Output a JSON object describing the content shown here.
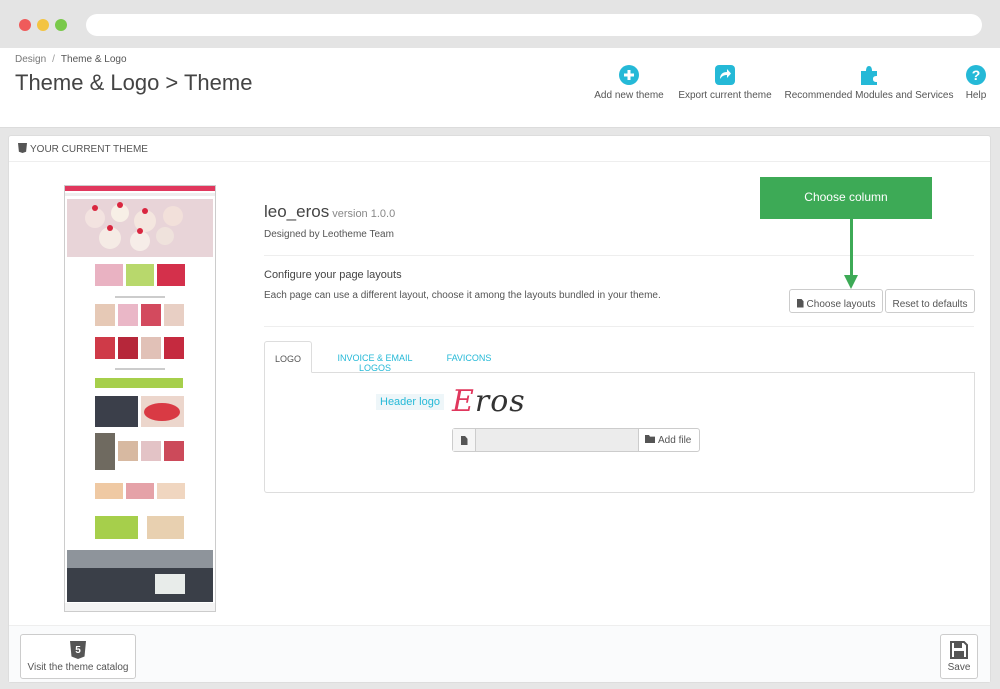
{
  "breadcrumb": {
    "parent": "Design",
    "separator": "/",
    "current": "Theme & Logo"
  },
  "page_title": "Theme & Logo > Theme",
  "toolbar": {
    "add_new_theme": "Add new theme",
    "export_current_theme": "Export current theme",
    "recommended": "Recommended Modules and Services",
    "help": "Help",
    "accent": "#25b9d7"
  },
  "panel": {
    "heading": "YOUR CURRENT THEME",
    "theme_name": "leo_eros",
    "theme_version": "version 1.0.0",
    "designer": "Designed by Leotheme Team",
    "config_title": "Configure your page layouts",
    "config_desc": "Each page can use a different layout, choose it among the layouts bundled in your theme.",
    "choose_layouts": "Choose layouts",
    "reset_defaults": "Reset to defaults",
    "callout": "Choose column",
    "callout_color": "#3daa56"
  },
  "tabs": [
    "LOGO",
    "INVOICE & EMAIL LOGOS",
    "FAVICONS"
  ],
  "logo_tab": {
    "header_logo_label": "Header logo",
    "logo_first": "E",
    "logo_rest": "ros",
    "add_file": "Add file"
  },
  "footer": {
    "catalog": "Visit the theme catalog",
    "save": "Save"
  }
}
